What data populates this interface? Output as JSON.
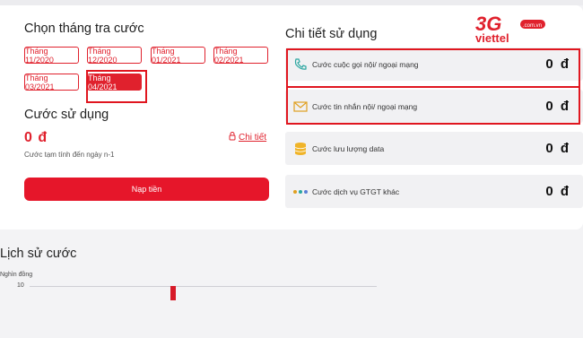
{
  "month_section": {
    "title": "Chọn tháng tra cước",
    "months": [
      {
        "label": "Tháng 11/2020",
        "active": false
      },
      {
        "label": "Tháng 12/2020",
        "active": false
      },
      {
        "label": "Tháng 01/2021",
        "active": false
      },
      {
        "label": "Tháng 02/2021",
        "active": false
      },
      {
        "label": "Tháng 03/2021",
        "active": false
      },
      {
        "label": "Tháng 04/2021",
        "active": true
      }
    ]
  },
  "usage": {
    "title": "Cước sử dụng",
    "amount": "0 đ",
    "note": "Cước tạm tính đến ngày n-1",
    "detail_link": "Chi tiết",
    "pay_button": "Nạp tiền"
  },
  "details": {
    "title": "Chi tiết sử dụng",
    "rows": [
      {
        "icon": "call-icon",
        "label": "Cước cuộc gọi nội/ ngoại mạng",
        "amount": "0 đ"
      },
      {
        "icon": "mail-icon",
        "label": "Cước tin nhắn nội/ ngoại mạng",
        "amount": "0 đ"
      },
      {
        "icon": "database-icon",
        "label": "Cước lưu lượng data",
        "amount": "0 đ"
      },
      {
        "icon": "dots-icon",
        "label": "Cước dịch vụ GTGT khác",
        "amount": "0 đ"
      }
    ]
  },
  "logo": {
    "main": "3G",
    "brand": "viettel",
    "suffix": ".com.vn"
  },
  "history": {
    "title": "Lịch sử cước",
    "unit": "Nghìn đồng",
    "tick": "10"
  },
  "colors": {
    "brand_red": "#e0212d",
    "row_bg": "#f1f1f3"
  }
}
